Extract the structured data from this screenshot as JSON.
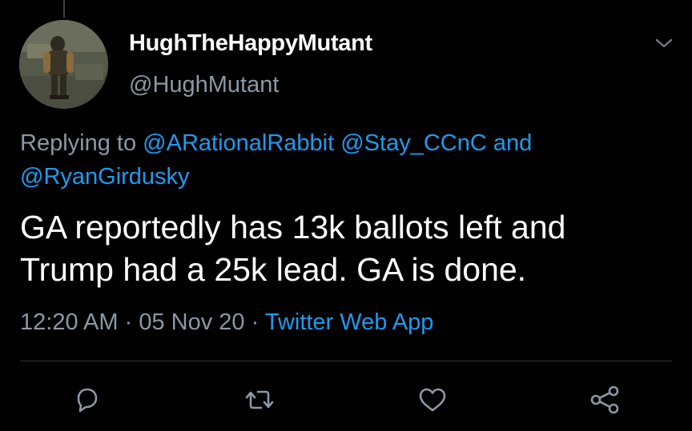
{
  "tweet": {
    "display_name": "HughTheHappyMutant",
    "handle": "@HughMutant",
    "replying_prefix": "Replying to",
    "replying_mentions": [
      "@ARationalRabbit",
      "@Stay_CCnC",
      "@RyanGirdusky"
    ],
    "replying_and": "and",
    "text_lines": [
      "GA reportedly has 13k ballots left and",
      "Trump had a 25k lead. GA is done."
    ],
    "time": "12:20 AM",
    "separator": "·",
    "date": "05 Nov 20",
    "source": "Twitter Web App"
  },
  "actions": {
    "reply_icon": "reply-icon",
    "retweet_icon": "retweet-icon",
    "like_icon": "heart-icon",
    "share_icon": "share-icon"
  },
  "colors": {
    "background": "#000000",
    "primary_text": "#ffffff",
    "secondary_text": "#8b98a5",
    "link": "#1d9bf0",
    "divider": "#2f3336"
  }
}
